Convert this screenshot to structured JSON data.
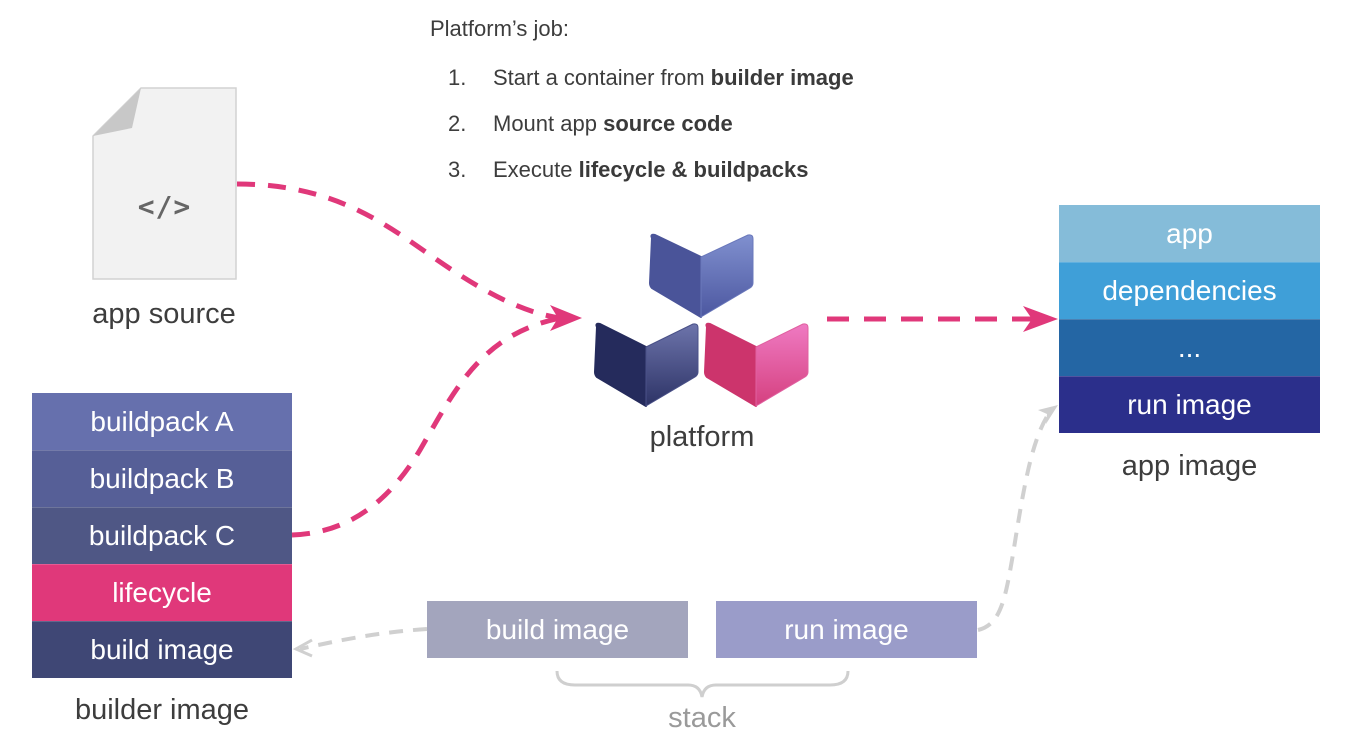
{
  "platform_job": {
    "title": "Platform’s job:",
    "steps": [
      {
        "num": "1.",
        "text": "Start a container from ",
        "bold": "builder image"
      },
      {
        "num": "2.",
        "text": "Mount app ",
        "bold": "source code"
      },
      {
        "num": "3.",
        "text": "Execute ",
        "bold": "lifecycle & buildpacks"
      }
    ]
  },
  "app_source": {
    "icon": "code-file-icon",
    "code_glyph": "</>",
    "label": "app source"
  },
  "platform": {
    "icon": "platform-logo-icon",
    "label": "platform"
  },
  "builder_image": {
    "label": "builder image",
    "layers": [
      {
        "label": "buildpack A",
        "color": "#6670ad"
      },
      {
        "label": "buildpack B",
        "color": "#565f97"
      },
      {
        "label": "buildpack C",
        "color": "#4f5785"
      },
      {
        "label": "lifecycle",
        "color": "#e0387a"
      },
      {
        "label": "build image",
        "color": "#3f4775"
      }
    ]
  },
  "app_image": {
    "label": "app image",
    "layers": [
      {
        "label": "app",
        "color": "#85bcd9"
      },
      {
        "label": "dependencies",
        "color": "#3f9fd8"
      },
      {
        "label": "...",
        "color": "#2466a4"
      },
      {
        "label": "run image",
        "color": "#2b2f8b"
      }
    ]
  },
  "stack": {
    "label": "stack",
    "build_image": {
      "label": "build image",
      "color": "#a3a5bd"
    },
    "run_image": {
      "label": "run image",
      "color": "#9a9cc9"
    }
  },
  "colors": {
    "accent_arrow": "#e0387a",
    "secondary_arrow": "#d0d0d0",
    "text": "#3d3d3d"
  }
}
